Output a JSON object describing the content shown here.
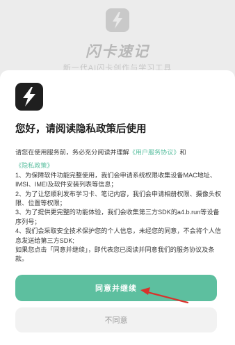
{
  "app": {
    "name": "闪卡速记",
    "subtitle": "新一代AI闪卡创作与学习工具"
  },
  "dialog": {
    "title": "您好，请阅读隐私政策后使用",
    "intro_prefix": "请您在使用服务前，务必充分阅读并理解",
    "user_agreement_link": "《用户服务协议》",
    "intro_and": "和",
    "privacy_policy_link": "《隐私政策》",
    "clauses": [
      "1、为保障软件功能完整使用，我们会申请系统权限收集设备MAC地址、IMSI、IMEI及软件安装列表等信息；",
      "2、为了让您顺利发布学习卡、笔记内容，我们会申请相册权限、摄像头权限、位置等权限；",
      "3、为了提供更完整的功能体验，我们会收集第三方SDK的a4.b.run等设备序列号；",
      "4、我们会采取安全技术保护您的个人信息，未经您的同意，不会将个人信息发送给第三方SDK;",
      "如果您点击「同意并继续」，即代表您已阅读并同意我们的服务协议及条款。"
    ],
    "agree_button": "同意并继续",
    "disagree_button": "不同意"
  },
  "colors": {
    "accent": "#5dbf9f",
    "link": "#5bbfa0",
    "annotation_arrow": "#d9322b"
  },
  "icons": {
    "app_icon": "lightning-bolt-icon",
    "annotation": "red-arrow-icon"
  }
}
